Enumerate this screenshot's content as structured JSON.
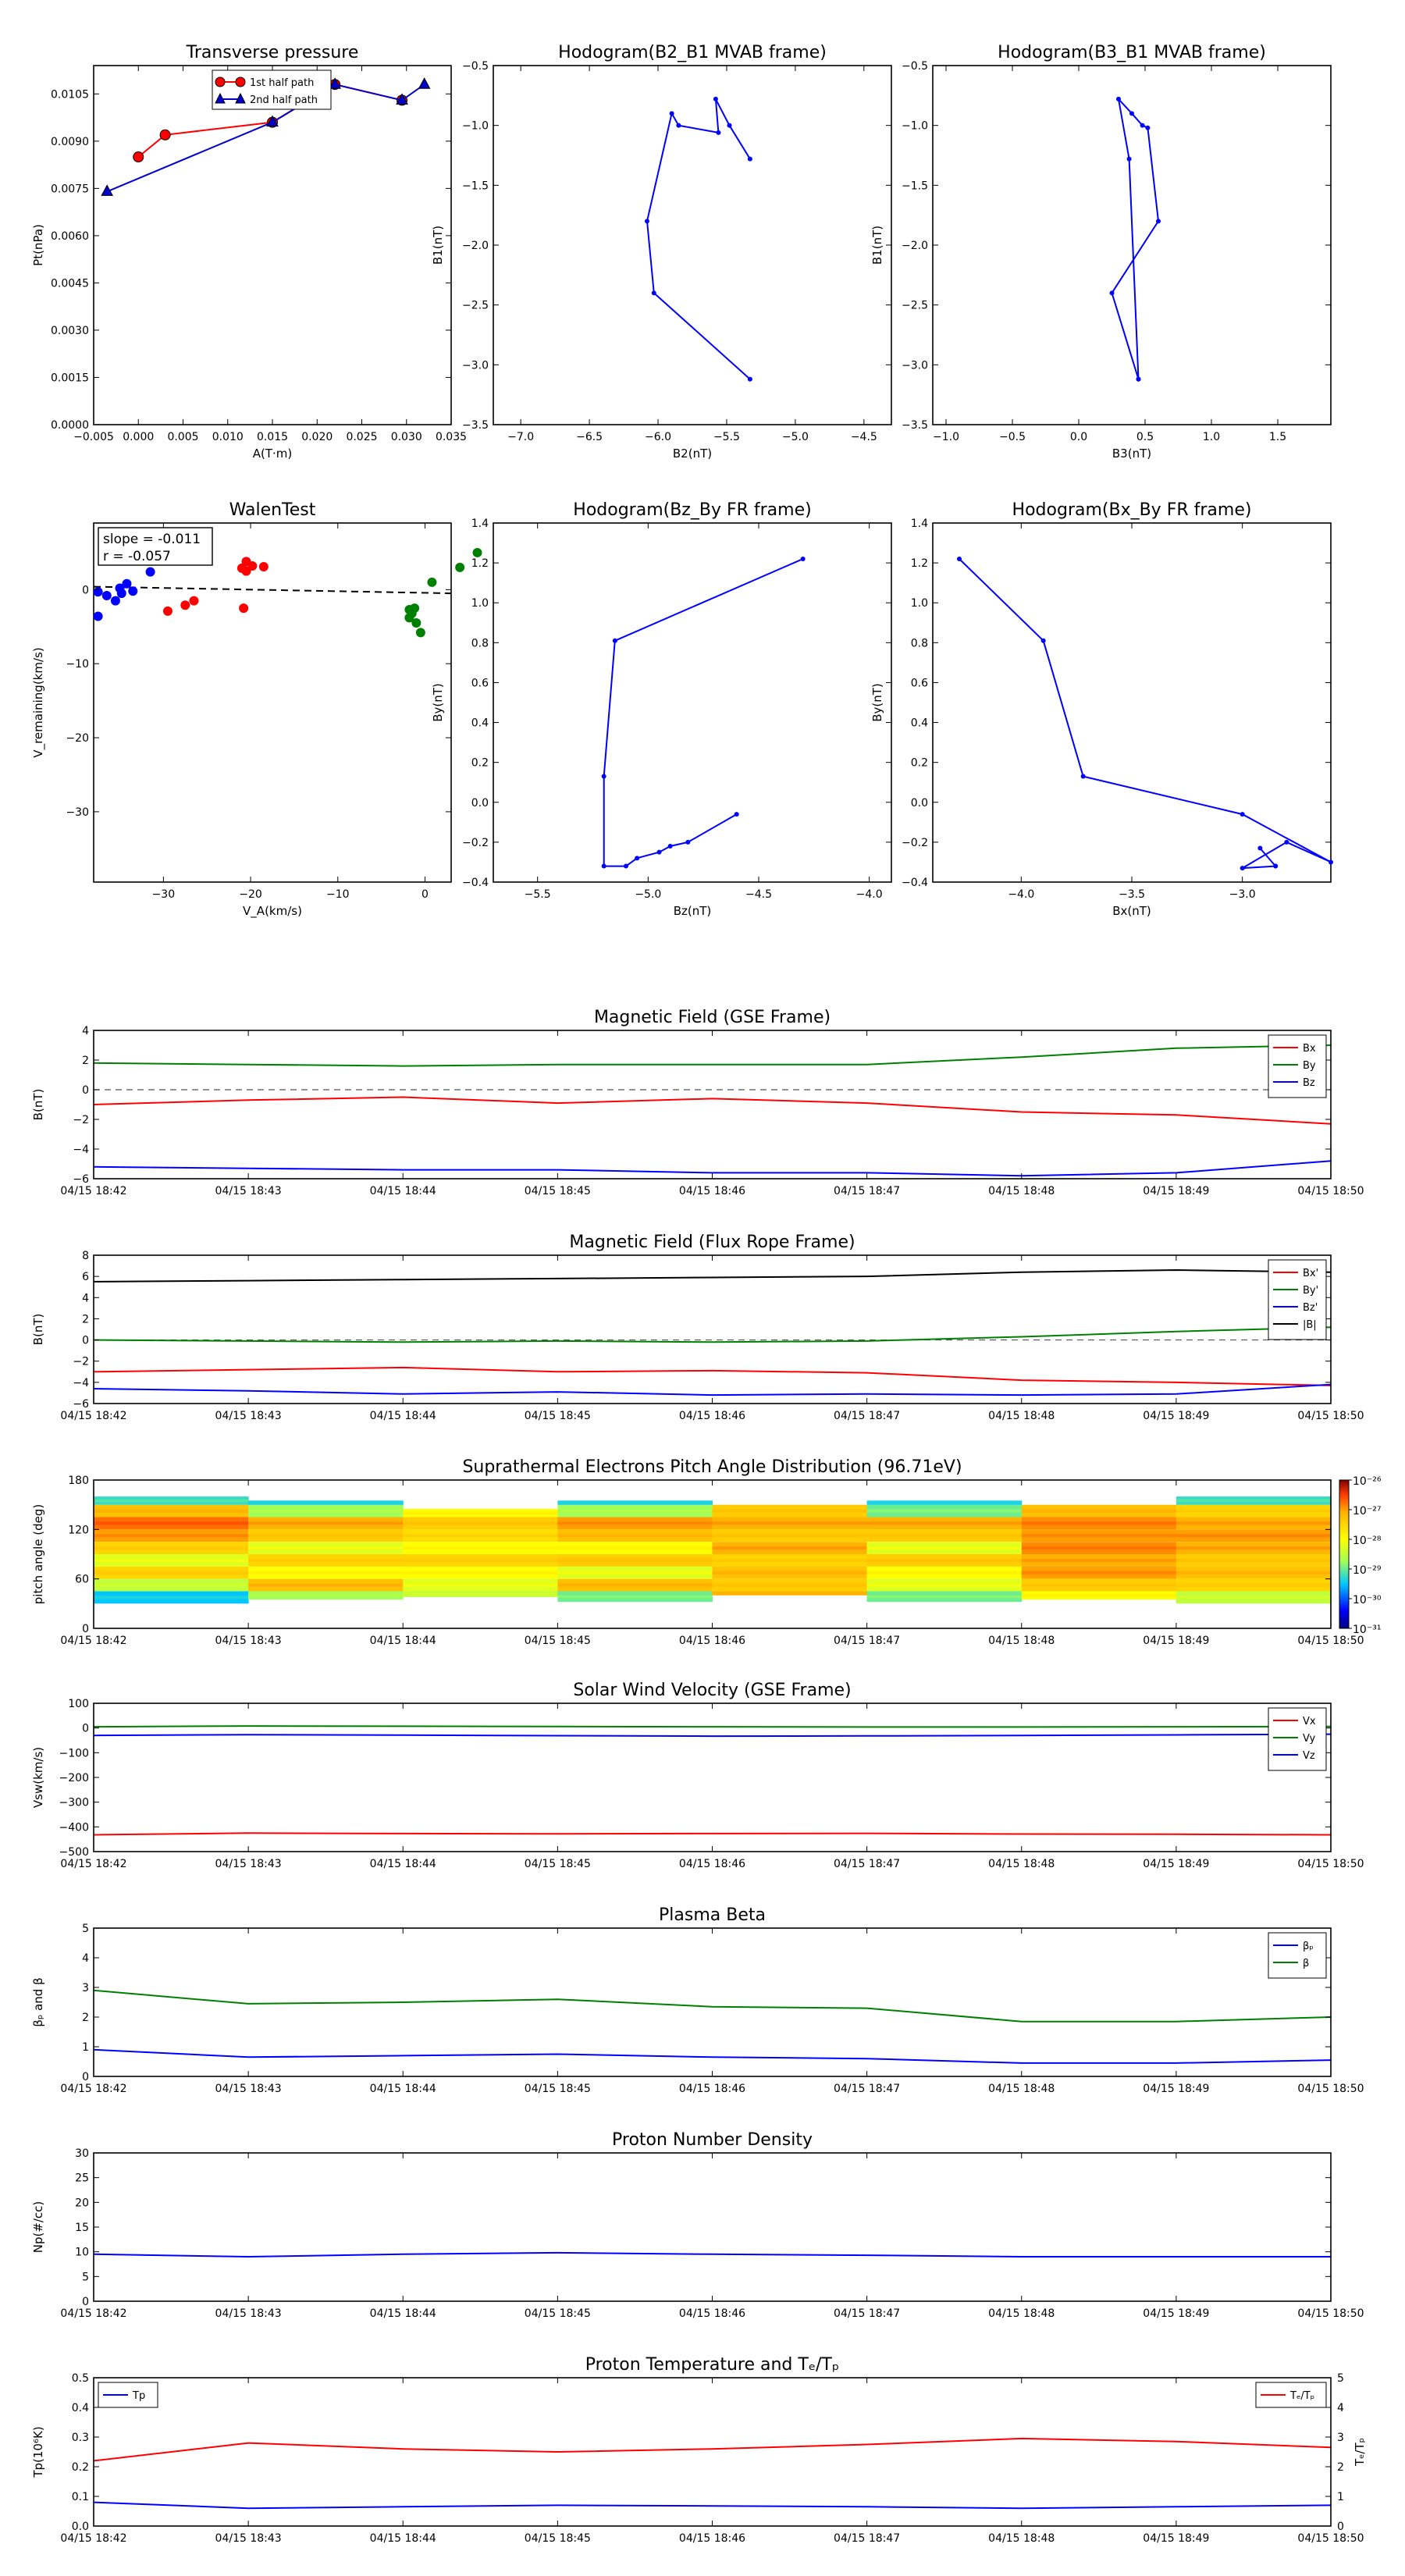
{
  "chart_data": [
    {
      "id": "transverse-pressure",
      "type": "line",
      "title": "Transverse pressure",
      "xlabel": "A(T·m)",
      "ylabel": "Pt(nPa)",
      "xlim": [
        -0.005,
        0.035
      ],
      "ylim": [
        0.0,
        0.0114
      ],
      "xticks": [
        -0.005,
        0.0,
        0.005,
        0.01,
        0.015,
        0.02,
        0.025,
        0.03,
        0.035
      ],
      "xtick_labels": [
        "−0.005",
        "0.000",
        "0.005",
        "0.010",
        "0.015",
        "0.020",
        "0.025",
        "0.030",
        "0.035"
      ],
      "yticks": [
        0.0,
        0.0015,
        0.003,
        0.0045,
        0.006,
        0.0075,
        0.009,
        0.0105
      ],
      "ytick_labels": [
        "0.0000",
        "0.0015",
        "0.0030",
        "0.0045",
        "0.0060",
        "0.0075",
        "0.0090",
        "0.0105"
      ],
      "legend": "top-center",
      "series": [
        {
          "name": "1st half path",
          "color": "#ff0000",
          "marker": "circle",
          "x": [
            0.0,
            0.003,
            0.015,
            0.022,
            0.0295
          ],
          "y": [
            0.0085,
            0.0092,
            0.0096,
            0.0108,
            0.0103
          ]
        },
        {
          "name": "2nd half path",
          "color": "#0000cc",
          "marker": "triangle",
          "x": [
            0.032,
            0.0295,
            0.022,
            0.015,
            -0.0035
          ],
          "y": [
            0.0108,
            0.0103,
            0.0108,
            0.0096,
            0.0074
          ]
        }
      ]
    },
    {
      "id": "hodogram-b2-b1",
      "type": "line",
      "title": "Hodogram(B2_B1 MVAB frame)",
      "xlabel": "B2(nT)",
      "ylabel": "B1(nT)",
      "xlim": [
        -7.2,
        -4.3
      ],
      "ylim": [
        -3.5,
        -0.5
      ],
      "xticks": [
        -7.0,
        -6.5,
        -6.0,
        -5.5,
        -5.0,
        -4.5
      ],
      "xtick_labels": [
        "−7.0",
        "−6.5",
        "−6.0",
        "−5.5",
        "−5.0",
        "−4.5"
      ],
      "yticks": [
        -3.5,
        -3.0,
        -2.5,
        -2.0,
        -1.5,
        -1.0,
        -0.5
      ],
      "ytick_labels": [
        "−3.5",
        "−3.0",
        "−2.5",
        "−2.0",
        "−1.5",
        "−1.0",
        "−0.5"
      ],
      "series": [
        {
          "color": "#0000ff",
          "x": [
            -5.33,
            -5.48,
            -5.58,
            -5.56,
            -5.85,
            -5.9,
            -6.08,
            -6.03,
            -5.33
          ],
          "y": [
            -1.28,
            -1.0,
            -0.78,
            -1.06,
            -1.0,
            -0.9,
            -1.8,
            -2.4,
            -3.12
          ]
        }
      ]
    },
    {
      "id": "hodogram-b3-b1",
      "type": "line",
      "title": "Hodogram(B3_B1 MVAB frame)",
      "xlabel": "B3(nT)",
      "ylabel": "B1(nT)",
      "xlim": [
        -1.1,
        1.9
      ],
      "ylim": [
        -3.5,
        -0.5
      ],
      "xticks": [
        -1.0,
        -0.5,
        0.0,
        0.5,
        1.0,
        1.5
      ],
      "xtick_labels": [
        "−1.0",
        "−0.5",
        "0.0",
        "0.5",
        "1.0",
        "1.5"
      ],
      "yticks": [
        -3.5,
        -3.0,
        -2.5,
        -2.0,
        -1.5,
        -1.0,
        -0.5
      ],
      "ytick_labels": [
        "−3.5",
        "−3.0",
        "−2.5",
        "−2.0",
        "−1.5",
        "−1.0",
        "−0.5"
      ],
      "series": [
        {
          "color": "#0000ff",
          "x": [
            0.45,
            0.38,
            0.3,
            0.4,
            0.48,
            0.52,
            0.6,
            0.25,
            0.45
          ],
          "y": [
            -3.12,
            -1.28,
            -0.78,
            -0.9,
            -1.0,
            -1.02,
            -1.8,
            -2.4,
            -3.12
          ]
        }
      ]
    },
    {
      "id": "walen-test",
      "type": "scatter",
      "title": "WalenTest",
      "xlabel": "V_A(km/s)",
      "ylabel": "V_remaining(km/s)",
      "annotations": [
        "slope = -0.011",
        "r  = -0.057"
      ],
      "xlim": [
        -38,
        3
      ],
      "ylim": [
        -39.5,
        9
      ],
      "xticks": [
        -30,
        -20,
        -10,
        0
      ],
      "xtick_labels": [
        "−30",
        "−20",
        "−10",
        "0"
      ],
      "yticks": [
        -30,
        -20,
        -10,
        0
      ],
      "ytick_labels": [
        "−30",
        "−20",
        "−10",
        "0"
      ],
      "fit_line": {
        "x": [
          -38,
          3
        ],
        "y": [
          0.4,
          -0.5
        ]
      },
      "series": [
        {
          "color": "#0000ff",
          "x": [
            -37.5,
            -36.5,
            -35.5,
            -35.0,
            -34.8,
            -34.2,
            -33.5,
            -31.5,
            -37.5
          ],
          "y": [
            -0.3,
            -0.8,
            -1.5,
            0.2,
            -0.5,
            0.8,
            -0.2,
            2.4,
            -3.6
          ]
        },
        {
          "color": "#ff0000",
          "x": [
            -29.5,
            -27.5,
            -26.5,
            -21.0,
            -20.5,
            -20.5,
            -19.8,
            -18.5,
            -20.8
          ],
          "y": [
            -2.9,
            -2.1,
            -1.5,
            2.9,
            2.5,
            3.8,
            3.2,
            3.1,
            -2.5
          ]
        },
        {
          "color": "#008000",
          "x": [
            -1.8,
            -1.5,
            -1.2,
            -1.0,
            -0.5,
            0.8,
            4.0,
            6.0,
            -1.8
          ],
          "y": [
            -2.7,
            -3.2,
            -2.5,
            -4.5,
            -5.8,
            1.0,
            3.0,
            5.0,
            -3.8
          ]
        }
      ]
    },
    {
      "id": "hodogram-bz-by",
      "type": "line",
      "title": "Hodogram(Bz_By FR frame)",
      "xlabel": "Bz(nT)",
      "ylabel": "By(nT)",
      "xlim": [
        -5.7,
        -3.9
      ],
      "ylim": [
        -0.4,
        1.4
      ],
      "xticks": [
        -5.5,
        -5.0,
        -4.5,
        -4.0
      ],
      "xtick_labels": [
        "−5.5",
        "−5.0",
        "−4.5",
        "−4.0"
      ],
      "yticks": [
        -0.4,
        -0.2,
        0.0,
        0.2,
        0.4,
        0.6,
        0.8,
        1.0,
        1.2,
        1.4
      ],
      "ytick_labels": [
        "−0.4",
        "−0.2",
        "0.0",
        "0.2",
        "0.4",
        "0.6",
        "0.8",
        "1.0",
        "1.2",
        "1.4"
      ],
      "series": [
        {
          "color": "#0000ff",
          "x": [
            -4.3,
            -5.15,
            -5.2,
            -5.2,
            -5.1,
            -5.05,
            -4.95,
            -4.9,
            -4.82,
            -4.6
          ],
          "y": [
            1.22,
            0.81,
            0.13,
            -0.32,
            -0.32,
            -0.28,
            -0.25,
            -0.22,
            -0.2,
            -0.06
          ]
        }
      ]
    },
    {
      "id": "hodogram-bx-by",
      "type": "line",
      "title": "Hodogram(Bx_By FR frame)",
      "xlabel": "Bx(nT)",
      "ylabel": "By(nT)",
      "xlim": [
        -4.4,
        -2.6
      ],
      "ylim": [
        -0.4,
        1.4
      ],
      "xticks": [
        -4.0,
        -3.5,
        -3.0
      ],
      "xtick_labels": [
        "−4.0",
        "−3.5",
        "−3.0"
      ],
      "yticks": [
        -0.4,
        -0.2,
        0.0,
        0.2,
        0.4,
        0.6,
        0.8,
        1.0,
        1.2,
        1.4
      ],
      "ytick_labels": [
        "−0.4",
        "−0.2",
        "0.0",
        "0.2",
        "0.4",
        "0.6",
        "0.8",
        "1.0",
        "1.2",
        "1.4"
      ],
      "series": [
        {
          "color": "#0000ff",
          "x": [
            -4.28,
            -3.9,
            -3.72,
            -3.0,
            -2.6,
            -2.8,
            -3.0,
            -2.85,
            -2.92,
            -2.85
          ],
          "y": [
            1.22,
            0.81,
            0.13,
            -0.06,
            -0.3,
            -0.2,
            -0.33,
            -0.32,
            -0.23,
            -0.32
          ]
        }
      ]
    },
    {
      "id": "magnetic-field-gse",
      "type": "line",
      "title": "Magnetic Field (GSE Frame)",
      "ylabel": "B(nT)",
      "ylim": [
        -6,
        4
      ],
      "yticks": [
        -6,
        -4,
        -2,
        0,
        2,
        4
      ],
      "ytick_labels": [
        "−6",
        "−4",
        "−2",
        "0",
        "2",
        "4"
      ],
      "zero_line": true,
      "legend": "top-right",
      "series": [
        {
          "name": "Bx",
          "color": "#ff0000",
          "values": [
            -1.0,
            -0.7,
            -0.5,
            -0.9,
            -0.6,
            -0.9,
            -1.5,
            -1.7,
            -2.3
          ]
        },
        {
          "name": "By",
          "color": "#008000",
          "values": [
            1.8,
            1.7,
            1.6,
            1.7,
            1.7,
            1.7,
            2.2,
            2.8,
            3.0
          ]
        },
        {
          "name": "Bz",
          "color": "#0000ff",
          "values": [
            -5.2,
            -5.3,
            -5.4,
            -5.4,
            -5.6,
            -5.6,
            -5.8,
            -5.6,
            -4.8
          ]
        }
      ]
    },
    {
      "id": "magnetic-field-fr",
      "type": "line",
      "title": "Magnetic Field (Flux Rope Frame)",
      "ylabel": "B(nT)",
      "ylim": [
        -6,
        8
      ],
      "yticks": [
        -6,
        -4,
        -2,
        0,
        2,
        4,
        6,
        8
      ],
      "ytick_labels": [
        "−6",
        "−4",
        "−2",
        "0",
        "2",
        "4",
        "6",
        "8"
      ],
      "zero_line": true,
      "legend": "top-right",
      "series": [
        {
          "name": "Bx'",
          "color": "#ff0000",
          "values": [
            -3.0,
            -2.8,
            -2.6,
            -3.0,
            -2.9,
            -3.1,
            -3.8,
            -4.0,
            -4.3
          ]
        },
        {
          "name": "By'",
          "color": "#008000",
          "values": [
            0.0,
            -0.1,
            -0.2,
            -0.1,
            -0.2,
            -0.1,
            0.3,
            0.8,
            1.2
          ]
        },
        {
          "name": "Bz'",
          "color": "#0000ff",
          "values": [
            -4.6,
            -4.8,
            -5.1,
            -4.9,
            -5.2,
            -5.1,
            -5.2,
            -5.1,
            -4.2
          ]
        },
        {
          "name": "|B|",
          "color": "#000000",
          "values": [
            5.5,
            5.6,
            5.7,
            5.8,
            5.9,
            6.0,
            6.4,
            6.6,
            6.4
          ]
        }
      ]
    },
    {
      "id": "suprathermal-pad",
      "type": "heatmap",
      "title": "Suprathermal Electrons Pitch Angle Distribution (96.71eV)",
      "ylabel": "pitch angle (deg)",
      "ylim": [
        0,
        180
      ],
      "yticks": [
        0,
        60,
        120,
        180
      ],
      "ytick_labels": [
        "0",
        "60",
        "120",
        "180"
      ],
      "colorbar_labels": [
        "10⁻²⁶",
        "10⁻²⁷",
        "10⁻²⁸",
        "10⁻²⁹",
        "10⁻³⁰",
        "10⁻³¹"
      ],
      "bin_edges": [
        30,
        45,
        60,
        75,
        90,
        105,
        120,
        135,
        150,
        160
      ],
      "columns": [
        {
          "lo": 30,
          "hi": 160,
          "levels": [
            0.3,
            0.5,
            0.7,
            0.55,
            0.7,
            0.8,
            0.85,
            0.75,
            0.35
          ]
        },
        {
          "lo": 35,
          "hi": 155,
          "levels": [
            0.45,
            0.75,
            0.6,
            0.7,
            0.55,
            0.72,
            0.78,
            0.45,
            0.3
          ]
        },
        {
          "lo": 38,
          "hi": 145,
          "levels": [
            0.5,
            0.55,
            0.6,
            0.7,
            0.6,
            0.68,
            0.72,
            0.6,
            0.55
          ]
        },
        {
          "lo": 32,
          "hi": 155,
          "levels": [
            0.4,
            0.75,
            0.55,
            0.72,
            0.6,
            0.75,
            0.8,
            0.45,
            0.3
          ]
        },
        {
          "lo": 40,
          "hi": 150,
          "levels": [
            0.75,
            0.72,
            0.75,
            0.7,
            0.78,
            0.72,
            0.78,
            0.72,
            0.7
          ]
        },
        {
          "lo": 32,
          "hi": 155,
          "levels": [
            0.4,
            0.55,
            0.6,
            0.72,
            0.55,
            0.72,
            0.78,
            0.4,
            0.3
          ]
        },
        {
          "lo": 35,
          "hi": 150,
          "levels": [
            0.6,
            0.72,
            0.8,
            0.78,
            0.82,
            0.8,
            0.82,
            0.75,
            0.7
          ]
        },
        {
          "lo": 28,
          "hi": 165,
          "levels": [
            0.5,
            0.7,
            0.75,
            0.72,
            0.78,
            0.8,
            0.78,
            0.7,
            0.35
          ]
        }
      ]
    },
    {
      "id": "solar-wind-velocity",
      "type": "line",
      "title": "Solar Wind Velocity (GSE Frame)",
      "ylabel": "Vsw(km/s)",
      "ylim": [
        -500,
        100
      ],
      "yticks": [
        -500,
        -400,
        -300,
        -200,
        -100,
        0,
        100
      ],
      "ytick_labels": [
        "−500",
        "−400",
        "−300",
        "−200",
        "−100",
        "0",
        "100"
      ],
      "legend": "top-right",
      "series": [
        {
          "name": "Vx",
          "color": "#ff0000",
          "values": [
            -432,
            -425,
            -427,
            -428,
            -427,
            -426,
            -429,
            -430,
            -432
          ]
        },
        {
          "name": "Vy",
          "color": "#008000",
          "values": [
            5,
            8,
            7,
            6,
            5,
            4,
            4,
            5,
            6
          ]
        },
        {
          "name": "Vz",
          "color": "#0000ff",
          "values": [
            -30,
            -27,
            -29,
            -31,
            -33,
            -32,
            -30,
            -28,
            -25
          ]
        }
      ]
    },
    {
      "id": "plasma-beta",
      "type": "line",
      "title": "Plasma Beta",
      "ylabel": "βₚ and β",
      "ylim": [
        0,
        5
      ],
      "yticks": [
        0,
        1,
        2,
        3,
        4,
        5
      ],
      "ytick_labels": [
        "0",
        "1",
        "2",
        "3",
        "4",
        "5"
      ],
      "legend": "top-right",
      "series": [
        {
          "name": "βₚ",
          "color": "#0000ff",
          "values": [
            0.9,
            0.65,
            0.7,
            0.75,
            0.65,
            0.6,
            0.45,
            0.45,
            0.55
          ]
        },
        {
          "name": "β",
          "color": "#008000",
          "values": [
            2.9,
            2.45,
            2.5,
            2.6,
            2.35,
            2.3,
            1.85,
            1.85,
            2.0
          ]
        }
      ]
    },
    {
      "id": "proton-density",
      "type": "line",
      "title": "Proton Number Density",
      "ylabel": "Np(#/cc)",
      "ylim": [
        0,
        30
      ],
      "yticks": [
        0,
        5,
        10,
        15,
        20,
        25,
        30
      ],
      "ytick_labels": [
        "0",
        "5",
        "10",
        "15",
        "20",
        "25",
        "30"
      ],
      "series": [
        {
          "color": "#0000ff",
          "values": [
            9.5,
            9.0,
            9.5,
            9.8,
            9.5,
            9.3,
            9.0,
            9.0,
            9.0
          ]
        }
      ]
    },
    {
      "id": "proton-temperature",
      "type": "line",
      "title": "Proton Temperature and Tₑ/Tₚ",
      "ylabel": "Tp(10⁶K)",
      "ylabel_right": "Tₑ/Tₚ",
      "ylim": [
        0,
        0.5
      ],
      "ylim_right": [
        0,
        5
      ],
      "yticks": [
        0.0,
        0.1,
        0.2,
        0.3,
        0.4,
        0.5
      ],
      "ytick_labels": [
        "0.0",
        "0.1",
        "0.2",
        "0.3",
        "0.4",
        "0.5"
      ],
      "yticks_right": [
        0,
        1,
        2,
        3,
        4,
        5
      ],
      "ytick_labels_right": [
        "0",
        "1",
        "2",
        "3",
        "4",
        "5"
      ],
      "legend": "top-left / top-right",
      "series": [
        {
          "name": "Tp",
          "color": "#0000ff",
          "axis": "left",
          "values": [
            0.08,
            0.06,
            0.065,
            0.07,
            0.068,
            0.065,
            0.06,
            0.065,
            0.07
          ]
        },
        {
          "name": "Tₑ/Tₚ",
          "color": "#ff0000",
          "axis": "right",
          "values": [
            2.2,
            2.8,
            2.6,
            2.5,
            2.6,
            2.75,
            2.95,
            2.85,
            2.65
          ]
        }
      ]
    }
  ],
  "time_axis": {
    "xtick_labels": [
      "04/15 18:42",
      "04/15 18:43",
      "04/15 18:44",
      "04/15 18:45",
      "04/15 18:46",
      "04/15 18:47",
      "04/15 18:48",
      "04/15 18:49",
      "04/15 18:50"
    ]
  },
  "colors": {
    "red": "#ff0000",
    "green": "#008000",
    "blue": "#0000ff",
    "black": "#000000"
  }
}
